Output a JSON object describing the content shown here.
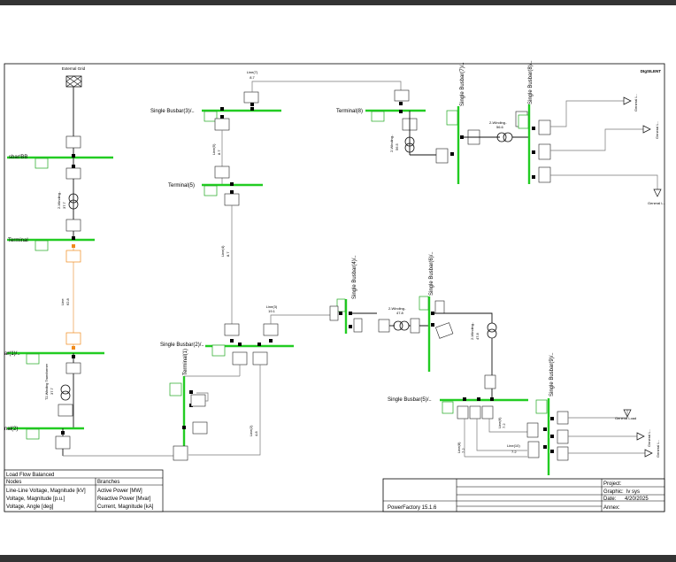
{
  "external_grid": {
    "label": "External Grid"
  },
  "brand": {
    "text": "DIgSILENT"
  },
  "nodes": {
    "bb": "sbar/BB",
    "terminal_left": "Terminal",
    "bar1": "ar(1)/..",
    "terminal2": "nal(2)",
    "sb3": "Single Busbar(3)/..",
    "terminal5": "Terminal(5)",
    "sb2": "Single Busbar(2)/..",
    "terminal1": "Terminal(1)",
    "terminal8": "Terminal(8)",
    "sb7": "Single Busbar(7)/..",
    "sb8": "Single Busbar(8)/..",
    "sb4": "Single Busbar(4)/..",
    "sb6": "Single Busbar(6)/..",
    "sb5": "Single Busbar(5)/..",
    "sb9": "Single Busbar(9)/.."
  },
  "branches": {
    "line7": {
      "name": "Line(7)",
      "value": "8.7"
    },
    "line5": {
      "name": "Line(5)",
      "value": "8.7"
    },
    "line4": {
      "name": "Line(4)",
      "value": "8.7"
    },
    "line3": {
      "name": "Line(3)",
      "value": "19.1"
    },
    "line_main": {
      "name": "Line",
      "value": "62.8"
    },
    "line2": {
      "name": "Line(2)",
      "value": "4.8"
    },
    "line6": {
      "name": "Line(6)",
      "value": "7.2"
    },
    "line10": {
      "name": "Line(10)",
      "value": "7.2"
    },
    "line8": {
      "name": "Line(8)",
      "value": "7.2"
    },
    "tr_a": {
      "name": "2-Winding..",
      "value": "37.7"
    },
    "tr_b": {
      "name": "T2-Winding Transformer",
      "value": "37.7"
    },
    "tr_c": {
      "name": "2-Winding..",
      "value": "56.5"
    },
    "tr_d": {
      "name": "2-Winding..",
      "value": "56.6"
    },
    "tr_e": {
      "name": "2-Winding..",
      "value": "47.8"
    },
    "tr_f": {
      "name": "2-Winding..",
      "value": "47.8"
    }
  },
  "loads": {
    "load1": "General L..",
    "load2": "General L..",
    "load3": "General L..",
    "load4": "General Load",
    "load5": "General L..",
    "load6": "General L.."
  },
  "legend": {
    "title": "Load Flow Balanced",
    "nodes_header": "Nodes",
    "branches_header": "Branches",
    "rows": [
      {
        "node": "Line-Line Voltage, Magnitude [kV]",
        "branch": "Active Power [MW]"
      },
      {
        "node": "Voltage, Magnitude [p.u.]",
        "branch": "Reactive Power [Mvar]"
      },
      {
        "node": "Voltage, Angle [deg]",
        "branch": "Current, Magnitude [kA]"
      }
    ]
  },
  "title_block": {
    "software": "PowerFactory 15.1.6",
    "project_label": "Project:",
    "graphic_label": "Graphic:",
    "graphic_value": "lv sys",
    "date_label": "Date:",
    "date_value": "4/20/2025",
    "annex_label": "Annex:"
  },
  "colors": {
    "busbar": "#22cc22",
    "highlight": "#f08a1c",
    "frame": "#000000"
  }
}
